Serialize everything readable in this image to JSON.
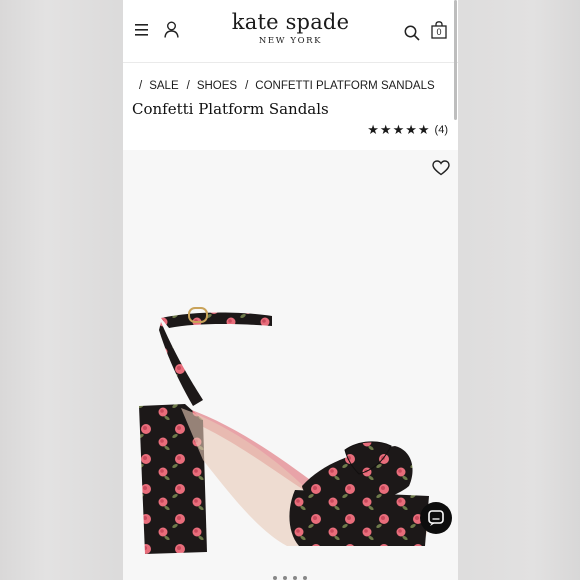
{
  "header": {
    "brand_name": "kate spade",
    "brand_sub": "NEW YORK",
    "cart_count": "0",
    "icons": [
      "menu-icon",
      "account-icon",
      "search-icon",
      "bag-icon"
    ]
  },
  "breadcrumb": {
    "items": [
      "SALE",
      "SHOES",
      "CONFETTI PLATFORM SANDALS"
    ]
  },
  "product": {
    "title": "Confetti Platform Sandals",
    "rating_stars": 5,
    "review_count": "(4)"
  },
  "colors": {
    "shoe_base": "#1c1818",
    "rose": "#e86d7b",
    "leaf": "#6e7a4a",
    "lining": "#e8a3a8",
    "buckle": "#c9a35a"
  }
}
